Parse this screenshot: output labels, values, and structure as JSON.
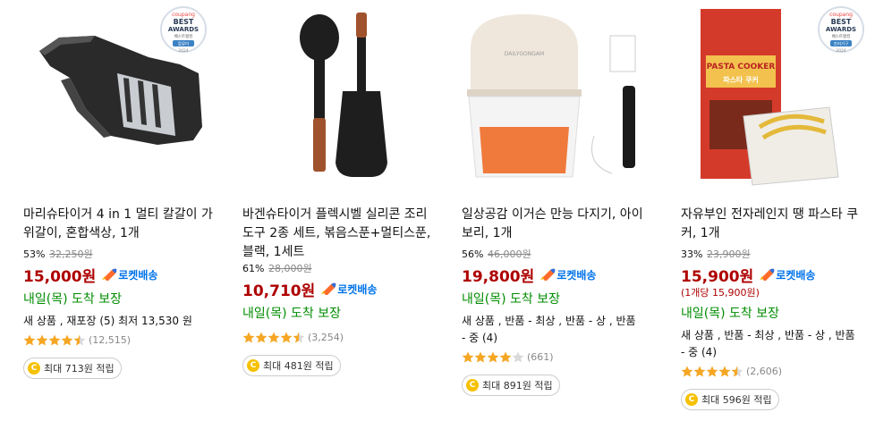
{
  "products": [
    {
      "title": "마리슈타이거 4 in 1 멀티 칼갈이 가위갈이, 혼합색상, 1개",
      "discount": "53%",
      "original_price": "32,250원",
      "price": "15,000원",
      "delivery_badge": "로켓배송",
      "unit_price": "",
      "arrival": "내일(목) 도착 보장",
      "seller_info": "새 상품 , 재포장 (5) 최저 13,530 원",
      "rating": 4.5,
      "review_count": "(12,515)",
      "cashback": "최대 713원 적립",
      "award": {
        "brand": "coupang",
        "line1": "BEST",
        "line2": "AWARDS",
        "sub": "베스트랭킹",
        "category": "칼갈이",
        "year": "2024"
      }
    },
    {
      "title": "바겐슈타이거 플렉시벨 실리콘 조리도구 2종 세트, 볶음스푼+멀티스푼, 블랙, 1세트",
      "discount": "61%",
      "original_price": "28,000원",
      "price": "10,710원",
      "delivery_badge": "로켓배송",
      "unit_price": "",
      "arrival": "내일(목) 도착 보장",
      "seller_info": "",
      "rating": 4.5,
      "review_count": "(3,254)",
      "cashback": "최대 481원 적립"
    },
    {
      "title": "일상공감 이거슨 만능 다지기, 아이보리, 1개",
      "discount": "56%",
      "original_price": "46,000원",
      "price": "19,800원",
      "delivery_badge": "로켓배송",
      "unit_price": "",
      "arrival": "내일(목) 도착 보장",
      "seller_info": "새 상품 , 반품 - 최상 , 반품 - 상 , 반품 - 중 (4)",
      "rating": 4.0,
      "review_count": "(661)",
      "cashback": "최대 891원 적립",
      "product_label": "DAILYGONGAM"
    },
    {
      "title": "자유부인 전자레인지 땡 파스타 쿠커, 1개",
      "discount": "33%",
      "original_price": "23,900원",
      "price": "15,900원",
      "delivery_badge": "로켓배송",
      "unit_price": "(1개당 15,900원)",
      "arrival": "내일(목) 도착 보장",
      "seller_info": "새 상품 , 반품 - 최상 , 반품 - 상 , 반품 - 중 (4)",
      "rating": 4.5,
      "review_count": "(2,606)",
      "cashback": "최대 596원 적립",
      "product_label": "PASTA COOKER",
      "product_label_kr": "파스타 쿠커",
      "award": {
        "brand": "coupang",
        "line1": "BEST",
        "line2": "AWARDS",
        "sub": "베스트랭킹",
        "category": "조리기구",
        "year": "2024"
      }
    }
  ],
  "colors": {
    "price_red": "#ae0000",
    "rocket_blue": "#0073e9",
    "arrival_green": "#008c00",
    "star_orange": "#f5a623",
    "coin_yellow": "#f6c100"
  }
}
